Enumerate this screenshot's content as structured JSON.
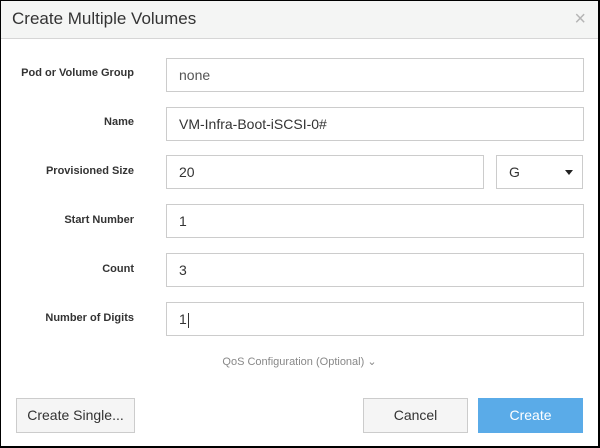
{
  "dialog": {
    "title": "Create Multiple Volumes",
    "close_icon": "×"
  },
  "fields": {
    "pod": {
      "label": "Pod or Volume Group",
      "value": "none"
    },
    "name": {
      "label": "Name",
      "value": "VM-Infra-Boot-iSCSI-0#"
    },
    "size": {
      "label": "Provisioned Size",
      "value": "20",
      "unit": "G"
    },
    "start": {
      "label": "Start Number",
      "value": "1"
    },
    "count": {
      "label": "Count",
      "value": "3"
    },
    "digits": {
      "label": "Number of Digits",
      "value": "1"
    }
  },
  "qos": {
    "label": "QoS Configuration (Optional)",
    "icon": "⌄"
  },
  "buttons": {
    "create_single": "Create Single...",
    "cancel": "Cancel",
    "create": "Create"
  },
  "colors": {
    "primary": "#5aabe8"
  }
}
